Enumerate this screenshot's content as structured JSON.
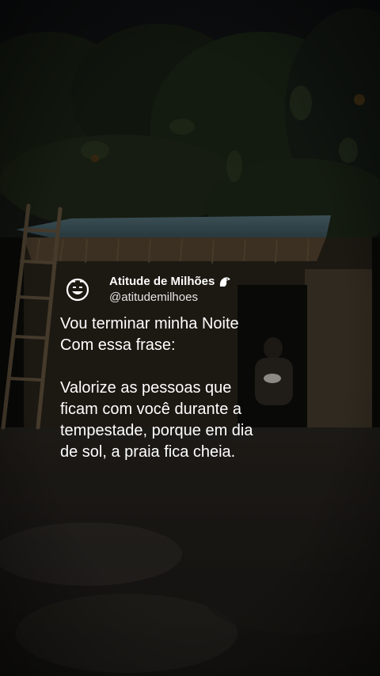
{
  "post": {
    "display_name": "Atitude de Milhões",
    "handle": "@atitudemilhoes",
    "lines_paragraph_1": [
      "Vou terminar minha Noite",
      "Com essa frase:"
    ],
    "lines_paragraph_2": [
      "Valorize as pessoas que",
      "ficam com você durante a",
      "tempestade, porque em dia",
      "de sol, a praia fica cheia."
    ],
    "avatar_icon": "smiley-face-icon",
    "badge_icon": "eagle-head-icon"
  },
  "background": {
    "scene": "rainy-night-hut",
    "colors": {
      "sky": "#14181a",
      "foliage": "#1b2416",
      "roof": "#4d6a74",
      "wall": "#3a3226",
      "ground": "#2a2620"
    }
  }
}
